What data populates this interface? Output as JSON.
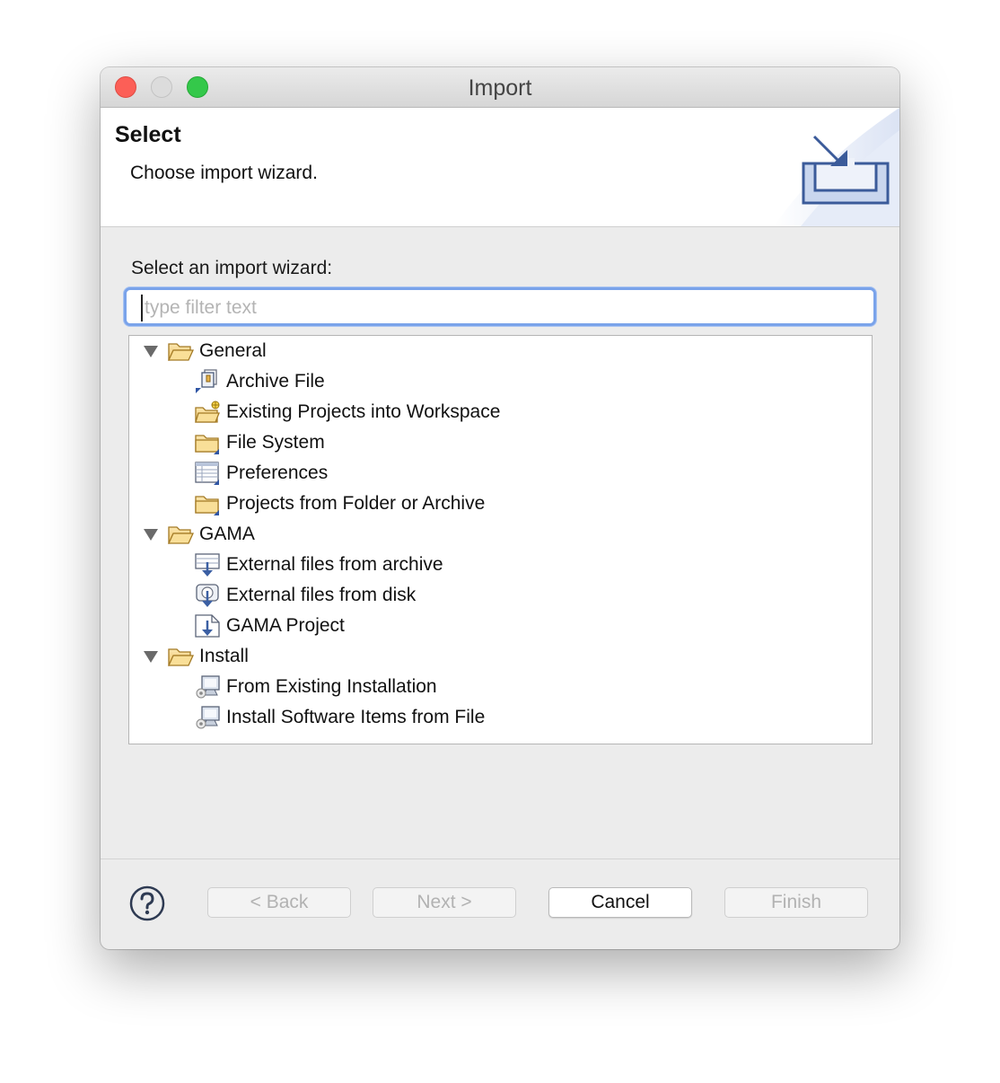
{
  "window": {
    "title": "Import"
  },
  "header": {
    "title": "Select",
    "description": "Choose import wizard.",
    "graphic_icon": "import-wizard-icon"
  },
  "wizard": {
    "label": "Select an import wizard:",
    "filter_placeholder": "type filter text",
    "filter_value": ""
  },
  "tree": [
    {
      "label": "General",
      "icon": "folder-open-icon",
      "expanded": true,
      "children": [
        {
          "label": "Archive File",
          "icon": "archive-file-icon"
        },
        {
          "label": "Existing Projects into Workspace",
          "icon": "existing-projects-icon"
        },
        {
          "label": "File System",
          "icon": "folder-icon"
        },
        {
          "label": "Preferences",
          "icon": "preferences-icon"
        },
        {
          "label": "Projects from Folder or Archive",
          "icon": "folder-icon"
        }
      ]
    },
    {
      "label": "GAMA",
      "icon": "folder-open-icon",
      "expanded": true,
      "children": [
        {
          "label": "External files from archive",
          "icon": "external-archive-icon"
        },
        {
          "label": "External files from disk",
          "icon": "external-disk-icon"
        },
        {
          "label": "GAMA Project",
          "icon": "gama-project-icon"
        }
      ]
    },
    {
      "label": "Install",
      "icon": "folder-open-icon",
      "expanded": true,
      "children": [
        {
          "label": "From Existing Installation",
          "icon": "install-icon"
        },
        {
          "label": "Install Software Items from File",
          "icon": "install-icon"
        }
      ]
    }
  ],
  "buttons": {
    "back": "< Back",
    "next": "Next >",
    "cancel": "Cancel",
    "finish": "Finish"
  },
  "colors": {
    "close": "#fc5f57",
    "minimize": "#dcdcdc",
    "maximize": "#34c84a",
    "focus_ring": "#7aa3ea",
    "folder": "#f5d68a",
    "arrow_blue": "#3b5fa3"
  }
}
